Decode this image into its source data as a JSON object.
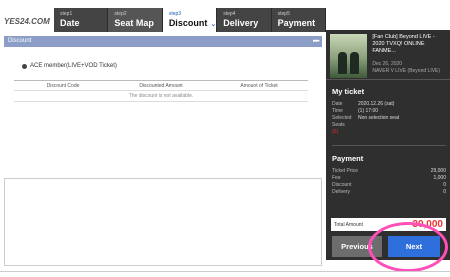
{
  "logo": {
    "text": "YES24.COM"
  },
  "steps": [
    {
      "num": "step1",
      "name": "Date"
    },
    {
      "num": "step2",
      "name": "Seat Map"
    },
    {
      "num": "step3",
      "name": "Discount"
    },
    {
      "num": "step4",
      "name": "Delivery"
    },
    {
      "num": "step5",
      "name": "Payment"
    }
  ],
  "discount": {
    "header": "Discount",
    "member_label": "ACE member(LIVE+VOD Ticket)",
    "columns": [
      "Discount Code",
      "Discounted Amount",
      "Amount of Ticket"
    ],
    "empty_message": "The discount is not available."
  },
  "event": {
    "title": "[Fan Club] Beyond LIVE - 2020 TVXQ! ONLINE FANME...",
    "date": "Dec 26, 2020",
    "venue": "NAVER V LIVE (Beyond LIVE)"
  },
  "my_ticket": {
    "title": "My ticket",
    "date_label": "Date",
    "date_value": "2020.12.26 (sat)",
    "time_label": "Time",
    "time_value": "(1) 17:00",
    "seats_label": "Selected Seats",
    "seats_value": "Non selection seat",
    "seats_count": "(0)"
  },
  "payment": {
    "title": "Payment",
    "rows": [
      {
        "label": "Ticket Price",
        "value": "29,000"
      },
      {
        "label": "Fee",
        "value": "1,000"
      },
      {
        "label": "Discount",
        "value": "0"
      },
      {
        "label": "Delivery",
        "value": "0"
      }
    ],
    "total_label": "Total Amount",
    "total_value": "30,000"
  },
  "buttons": {
    "previous": "Previous",
    "next": "Next"
  },
  "colors": {
    "accent": "#2f6fdc",
    "highlight": "#ff4fb8",
    "total": "#e33333"
  }
}
